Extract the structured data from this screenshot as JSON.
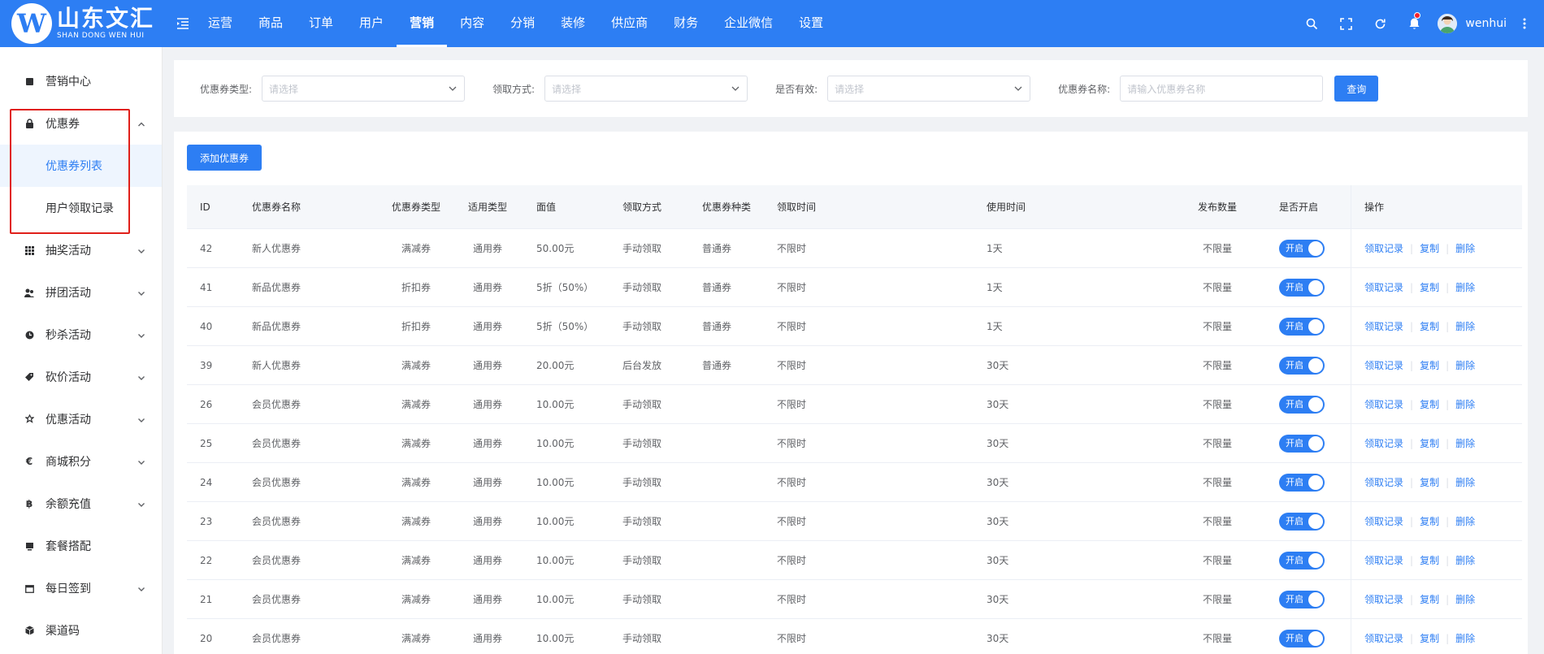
{
  "brand": {
    "mark": "W",
    "name": "山东文汇",
    "subtitle": "SHAN DONG WEN HUI"
  },
  "nav": [
    {
      "label": "运营"
    },
    {
      "label": "商品"
    },
    {
      "label": "订单"
    },
    {
      "label": "用户"
    },
    {
      "label": "营销"
    },
    {
      "label": "内容"
    },
    {
      "label": "分销"
    },
    {
      "label": "装修"
    },
    {
      "label": "供应商"
    },
    {
      "label": "财务"
    },
    {
      "label": "企业微信"
    },
    {
      "label": "设置"
    }
  ],
  "nav_active": "营销",
  "user": {
    "name": "wenhui"
  },
  "sidebar": {
    "items": [
      {
        "label": "营销中心"
      },
      {
        "label": "优惠券"
      },
      {
        "label": "优惠券列表"
      },
      {
        "label": "用户领取记录"
      },
      {
        "label": "抽奖活动"
      },
      {
        "label": "拼团活动"
      },
      {
        "label": "秒杀活动"
      },
      {
        "label": "砍价活动"
      },
      {
        "label": "优惠活动"
      },
      {
        "label": "商城积分"
      },
      {
        "label": "余额充值"
      },
      {
        "label": "套餐搭配"
      },
      {
        "label": "每日签到"
      },
      {
        "label": "渠道码"
      }
    ]
  },
  "filters": {
    "type_label": "优惠券类型:",
    "type_placeholder": "请选择",
    "get_label": "领取方式:",
    "get_placeholder": "请选择",
    "valid_label": "是否有效:",
    "valid_placeholder": "请选择",
    "name_label": "优惠券名称:",
    "name_placeholder": "请输入优惠券名称",
    "query_label": "查询"
  },
  "add_button": "添加优惠券",
  "table": {
    "headers": {
      "id": "ID",
      "name": "优惠券名称",
      "type": "优惠券类型",
      "apply": "适用类型",
      "face": "面值",
      "get": "领取方式",
      "kind": "优惠券种类",
      "time": "领取时间",
      "use": "使用时间",
      "num": "发布数量",
      "open": "是否开启",
      "op": "操作"
    },
    "switch_label": "开启",
    "ops": {
      "record": "领取记录",
      "copy": "复制",
      "delete": "删除"
    },
    "rows": [
      {
        "id": "42",
        "name": "新人优惠券",
        "type": "满减券",
        "apply": "通用券",
        "face": "50.00元",
        "get": "手动领取",
        "kind": "普通券",
        "time": "不限时",
        "use": "1天",
        "num": "不限量"
      },
      {
        "id": "41",
        "name": "新品优惠券",
        "type": "折扣券",
        "apply": "通用券",
        "face": "5折（50%）",
        "get": "手动领取",
        "kind": "普通券",
        "time": "不限时",
        "use": "1天",
        "num": "不限量"
      },
      {
        "id": "40",
        "name": "新品优惠券",
        "type": "折扣券",
        "apply": "通用券",
        "face": "5折（50%）",
        "get": "手动领取",
        "kind": "普通券",
        "time": "不限时",
        "use": "1天",
        "num": "不限量"
      },
      {
        "id": "39",
        "name": "新人优惠券",
        "type": "满减券",
        "apply": "通用券",
        "face": "20.00元",
        "get": "后台发放",
        "kind": "普通券",
        "time": "不限时",
        "use": "30天",
        "num": "不限量"
      },
      {
        "id": "26",
        "name": "会员优惠券",
        "type": "满减券",
        "apply": "通用券",
        "face": "10.00元",
        "get": "手动领取",
        "kind": "",
        "time": "不限时",
        "use": "30天",
        "num": "不限量"
      },
      {
        "id": "25",
        "name": "会员优惠券",
        "type": "满减券",
        "apply": "通用券",
        "face": "10.00元",
        "get": "手动领取",
        "kind": "",
        "time": "不限时",
        "use": "30天",
        "num": "不限量"
      },
      {
        "id": "24",
        "name": "会员优惠券",
        "type": "满减券",
        "apply": "通用券",
        "face": "10.00元",
        "get": "手动领取",
        "kind": "",
        "time": "不限时",
        "use": "30天",
        "num": "不限量"
      },
      {
        "id": "23",
        "name": "会员优惠券",
        "type": "满减券",
        "apply": "通用券",
        "face": "10.00元",
        "get": "手动领取",
        "kind": "",
        "time": "不限时",
        "use": "30天",
        "num": "不限量"
      },
      {
        "id": "22",
        "name": "会员优惠券",
        "type": "满减券",
        "apply": "通用券",
        "face": "10.00元",
        "get": "手动领取",
        "kind": "",
        "time": "不限时",
        "use": "30天",
        "num": "不限量"
      },
      {
        "id": "21",
        "name": "会员优惠券",
        "type": "满减券",
        "apply": "通用券",
        "face": "10.00元",
        "get": "手动领取",
        "kind": "",
        "time": "不限时",
        "use": "30天",
        "num": "不限量"
      },
      {
        "id": "20",
        "name": "会员优惠券",
        "type": "满减券",
        "apply": "通用券",
        "face": "10.00元",
        "get": "手动领取",
        "kind": "",
        "time": "不限时",
        "use": "30天",
        "num": "不限量"
      }
    ]
  }
}
